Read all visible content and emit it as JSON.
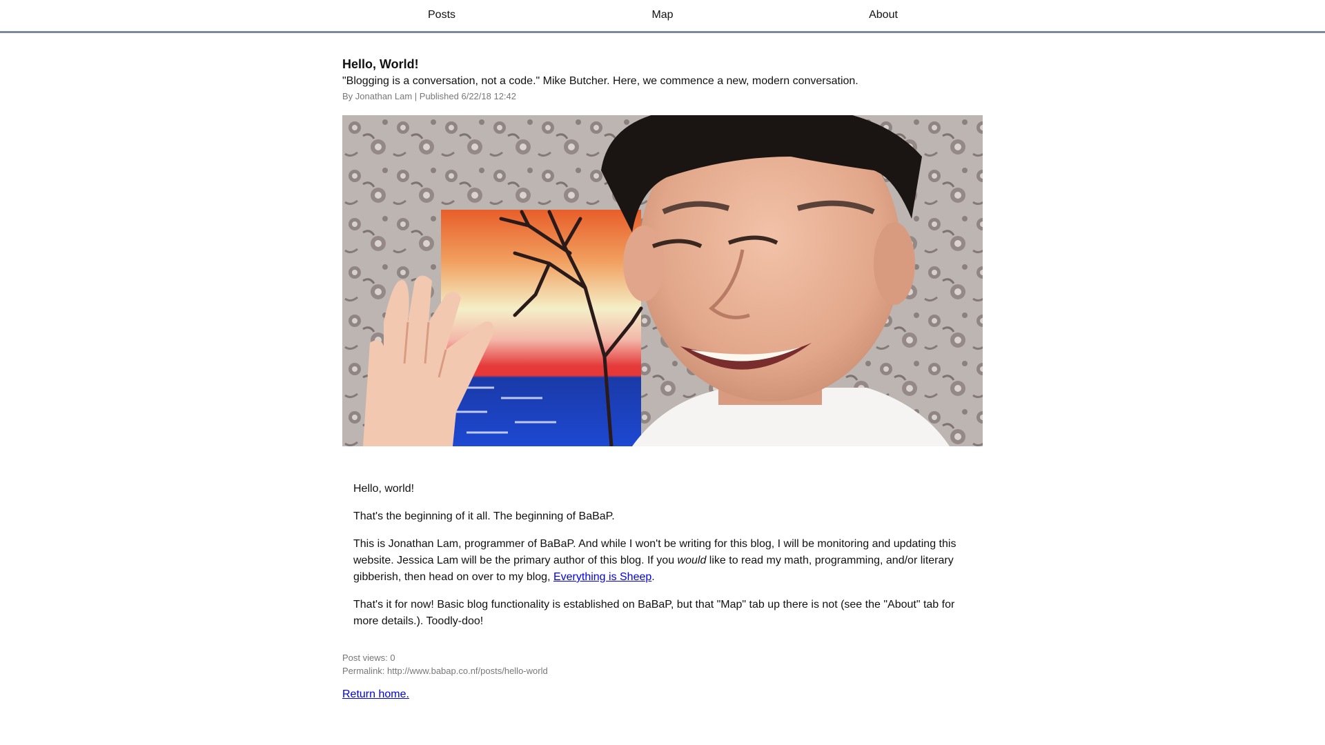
{
  "nav": {
    "items": [
      {
        "label": "Posts"
      },
      {
        "label": "Map"
      },
      {
        "label": "About"
      }
    ]
  },
  "post": {
    "title": "Hello, World!",
    "subtitle": "\"Blogging is a conversation, not a code.\" Mike Butcher. Here, we commence a new, modern conversation.",
    "meta": "By Jonathan Lam | Published 6/22/18 12:42",
    "body": {
      "p1": "Hello, world!",
      "p2": "That's the beginning of it all. The beginning of BaBaP.",
      "p3_before": "This is Jonathan Lam, programmer of BaBaP. And while I won't be writing for this blog, I will be monitoring and updating this website. Jessica Lam will be the primary author of this blog. If you ",
      "p3_emphasis": "would",
      "p3_middle": " like to read my math, programming, and/or literary gibberish, then head on over to my blog, ",
      "p3_link": "Everything is Sheep",
      "p3_after": ".",
      "p4": "That's it for now! Basic blog functionality is established on BaBaP, but that \"Map\" tab up there is not (see the \"About\" tab for more details.). Toodly-doo!"
    },
    "views": "Post views: 0",
    "permalink": "Permalink: http://www.babap.co.nf/posts/hello-world",
    "return_home": "Return home."
  },
  "colors": {
    "nav_border": "#7b8a9b",
    "link": "#0000ee",
    "meta_text": "#777777"
  }
}
